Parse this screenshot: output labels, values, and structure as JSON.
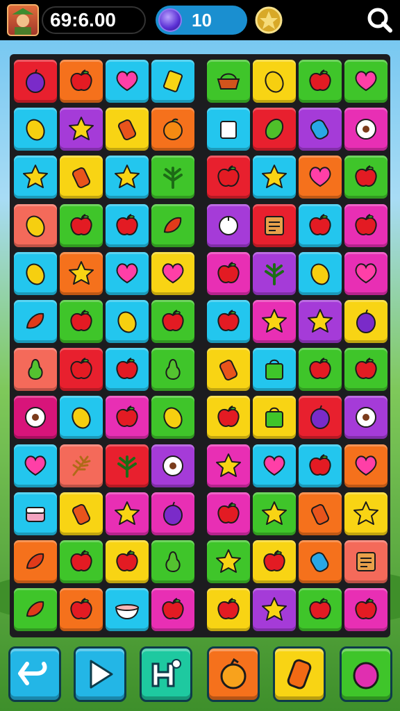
{
  "hud": {
    "timer": "69:6.00",
    "gems": "10",
    "icons": {
      "avatar": "player-avatar",
      "gem": "purple-gem-icon",
      "coin": "gold-coin-icon",
      "search": "search-icon"
    }
  },
  "palette": {
    "R": "#e8202e",
    "O": "#f5711c",
    "Y": "#f8d414",
    "G": "#3fc52a",
    "B": "#23c6ee",
    "P": "#a53bd8",
    "M": "#e82fb4",
    "S": "#f46a5a",
    "D": "#d8147a"
  },
  "board": {
    "left": [
      [
        [
          "R",
          "plum"
        ],
        [
          "O",
          "apple"
        ],
        [
          "B",
          "heart"
        ],
        [
          "B",
          "card"
        ]
      ],
      [
        [
          "B",
          "lemon"
        ],
        [
          "P",
          "star"
        ],
        [
          "Y",
          "bottle"
        ],
        [
          "O",
          "orange"
        ]
      ],
      [
        [
          "B",
          "star"
        ],
        [
          "Y",
          "bottle"
        ],
        [
          "B",
          "star"
        ],
        [
          "G",
          "leaf"
        ]
      ],
      [
        [
          "S",
          "lemon"
        ],
        [
          "G",
          "apple"
        ],
        [
          "B",
          "apple"
        ],
        [
          "G",
          "pepper"
        ]
      ],
      [
        [
          "B",
          "lemon"
        ],
        [
          "O",
          "star"
        ],
        [
          "B",
          "heart"
        ],
        [
          "Y",
          "heart"
        ]
      ],
      [
        [
          "B",
          "pepper"
        ],
        [
          "G",
          "apple"
        ],
        [
          "B",
          "lemon"
        ],
        [
          "G",
          "apple"
        ]
      ],
      [
        [
          "S",
          "pear"
        ],
        [
          "R",
          "apple"
        ],
        [
          "B",
          "apple"
        ],
        [
          "G",
          "pear"
        ]
      ],
      [
        [
          "D",
          "flower"
        ],
        [
          "B",
          "lemon"
        ],
        [
          "M",
          "apple"
        ],
        [
          "G",
          "lemon"
        ]
      ],
      [
        [
          "B",
          "heart"
        ],
        [
          "S",
          "wheat"
        ],
        [
          "R",
          "leaf"
        ],
        [
          "P",
          "flower"
        ]
      ],
      [
        [
          "B",
          "cake"
        ],
        [
          "Y",
          "bottle"
        ],
        [
          "M",
          "star"
        ],
        [
          "M",
          "plum"
        ]
      ],
      [
        [
          "O",
          "pepper"
        ],
        [
          "G",
          "apple"
        ],
        [
          "Y",
          "apple"
        ],
        [
          "G",
          "pear"
        ]
      ],
      [
        [
          "G",
          "pepper"
        ],
        [
          "O",
          "apple"
        ],
        [
          "B",
          "bowl"
        ],
        [
          "M",
          "apple"
        ]
      ]
    ],
    "right": [
      [
        [
          "G",
          "basket"
        ],
        [
          "Y",
          "lemon"
        ],
        [
          "G",
          "apple"
        ],
        [
          "G",
          "heart"
        ]
      ],
      [
        [
          "B",
          "cup"
        ],
        [
          "R",
          "lime"
        ],
        [
          "P",
          "candy"
        ],
        [
          "M",
          "flower"
        ]
      ],
      [
        [
          "R",
          "apple"
        ],
        [
          "B",
          "star"
        ],
        [
          "O",
          "heart"
        ],
        [
          "G",
          "apple"
        ]
      ],
      [
        [
          "P",
          "bulb"
        ],
        [
          "R",
          "box"
        ],
        [
          "B",
          "apple"
        ],
        [
          "M",
          "apple"
        ]
      ],
      [
        [
          "M",
          "apple"
        ],
        [
          "P",
          "leaf"
        ],
        [
          "B",
          "lemon"
        ],
        [
          "M",
          "heart"
        ]
      ],
      [
        [
          "B",
          "apple"
        ],
        [
          "M",
          "star"
        ],
        [
          "P",
          "star"
        ],
        [
          "Y",
          "plum"
        ]
      ],
      [
        [
          "Y",
          "bottle"
        ],
        [
          "B",
          "bag"
        ],
        [
          "G",
          "apple"
        ],
        [
          "G",
          "apple"
        ]
      ],
      [
        [
          "Y",
          "apple"
        ],
        [
          "Y",
          "bag"
        ],
        [
          "R",
          "plum"
        ],
        [
          "P",
          "flower"
        ]
      ],
      [
        [
          "M",
          "star"
        ],
        [
          "B",
          "heart"
        ],
        [
          "B",
          "apple"
        ],
        [
          "O",
          "heart"
        ]
      ],
      [
        [
          "M",
          "apple"
        ],
        [
          "G",
          "star"
        ],
        [
          "O",
          "bottle"
        ],
        [
          "Y",
          "star"
        ]
      ],
      [
        [
          "G",
          "star"
        ],
        [
          "Y",
          "apple"
        ],
        [
          "O",
          "candy"
        ],
        [
          "S",
          "box"
        ]
      ],
      [
        [
          "Y",
          "apple"
        ],
        [
          "P",
          "star"
        ],
        [
          "G",
          "apple"
        ],
        [
          "M",
          "apple"
        ]
      ]
    ]
  },
  "controls": [
    {
      "name": "undo-button",
      "icon": "undo-arrow-icon",
      "color": "#23b6e6"
    },
    {
      "name": "play-button",
      "icon": "play-icon",
      "color": "#23b6e6"
    },
    {
      "name": "hint-button",
      "icon": "hint-icon",
      "color": "#1ec9a0"
    },
    {
      "name": "orange-booster-button",
      "icon": "orange-icon",
      "color": "#f5711c"
    },
    {
      "name": "bottle-booster-button",
      "icon": "bottle-icon",
      "color": "#f8d414"
    },
    {
      "name": "plum-booster-button",
      "icon": "plum-icon",
      "color": "#3fc52a"
    }
  ]
}
